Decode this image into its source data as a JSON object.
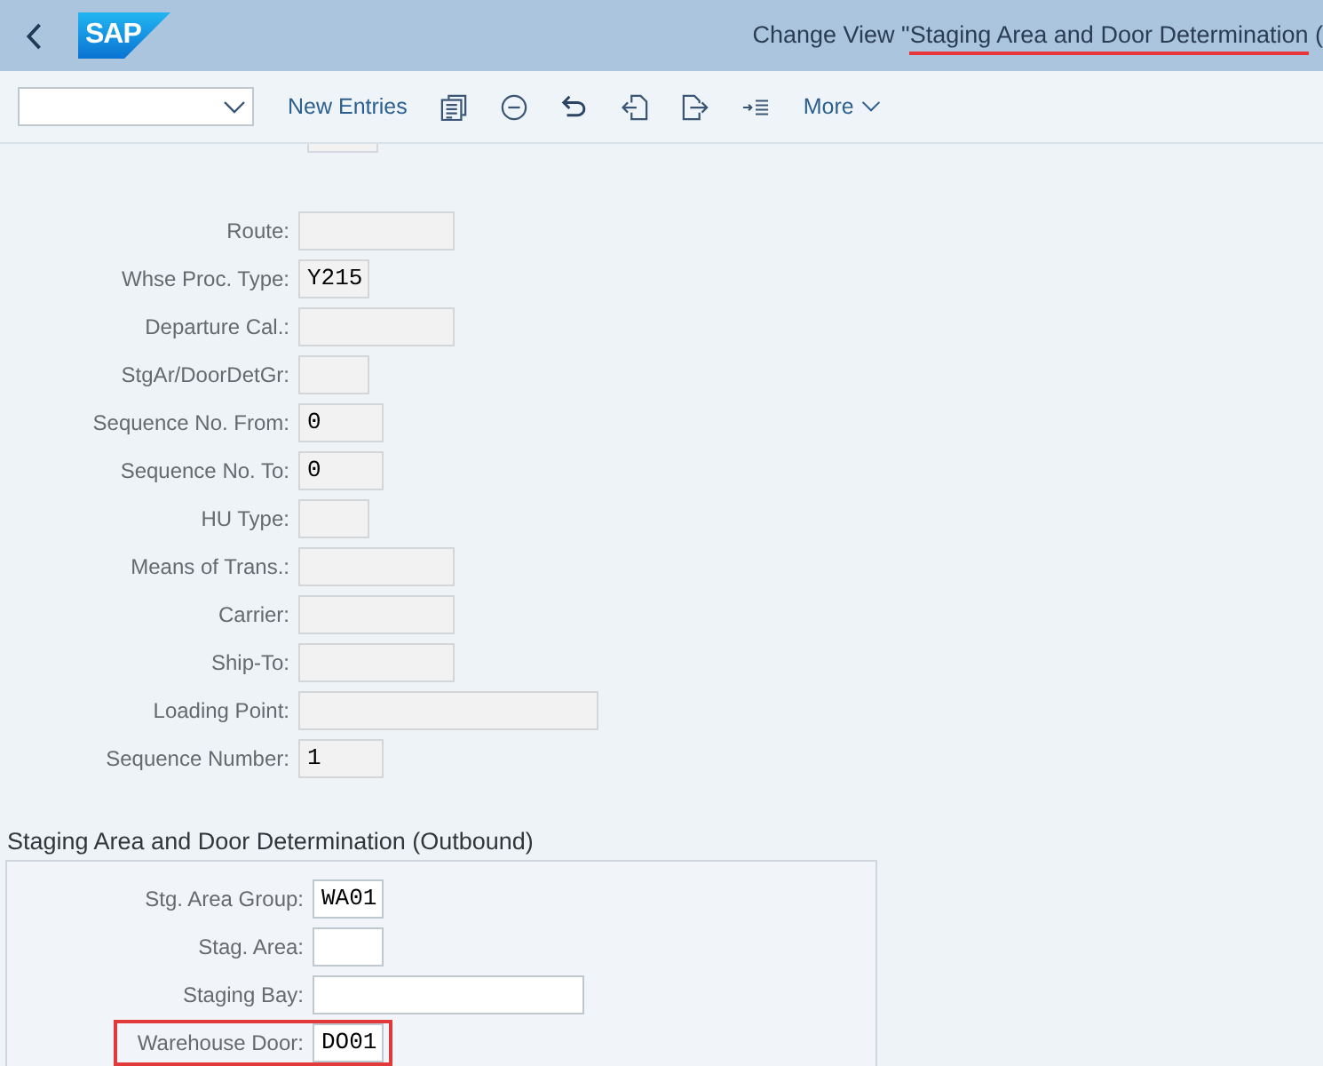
{
  "header": {
    "logo": "SAP",
    "title": [
      {
        "text": "Change View \"",
        "highlighted": false
      },
      {
        "text": "Staging Area and Door Determination",
        "highlighted": true
      },
      {
        "text": " (",
        "highlighted": false
      }
    ]
  },
  "toolbar": {
    "new_entries": "New Entries",
    "more": "More"
  },
  "form": {
    "fields": [
      {
        "label": "Route:",
        "editable": false,
        "highlighted": false
      },
      {
        "label": "Whse Proc. Type:",
        "value": "Y215",
        "editable": false,
        "highlighted": false
      },
      {
        "label": "Departure Cal.:",
        "editable": false,
        "highlighted": false
      },
      {
        "label": "StgAr/DoorDetGr:",
        "editable": false,
        "highlighted": false
      },
      {
        "label": "Sequence No. From:",
        "value": "0",
        "editable": false,
        "highlighted": false
      },
      {
        "label": "Sequence No. To:",
        "value": "0",
        "editable": false,
        "highlighted": false
      },
      {
        "label": "HU Type:",
        "editable": false,
        "highlighted": false
      },
      {
        "label": "Means of Trans.:",
        "editable": false,
        "highlighted": false
      },
      {
        "label": "Carrier:",
        "editable": false,
        "highlighted": false
      },
      {
        "label": "Ship-To:",
        "editable": false,
        "highlighted": false
      },
      {
        "label": "Loading Point:",
        "editable": false,
        "highlighted": false
      },
      {
        "label": "Sequence Number:",
        "value": "1",
        "editable": false,
        "highlighted": false
      }
    ]
  },
  "section": {
    "title": "Staging Area and Door Determination (Outbound)",
    "fields": [
      {
        "label": "Stg. Area Group:",
        "value": "WA01",
        "editable": true,
        "highlighted": false
      },
      {
        "label": "Stag. Area:",
        "editable": true,
        "highlighted": false
      },
      {
        "label": "Staging Bay:",
        "editable": true,
        "highlighted": false
      },
      {
        "label": "Warehouse Door:",
        "value": "DO01",
        "editable": true,
        "highlighted": true
      }
    ]
  }
}
